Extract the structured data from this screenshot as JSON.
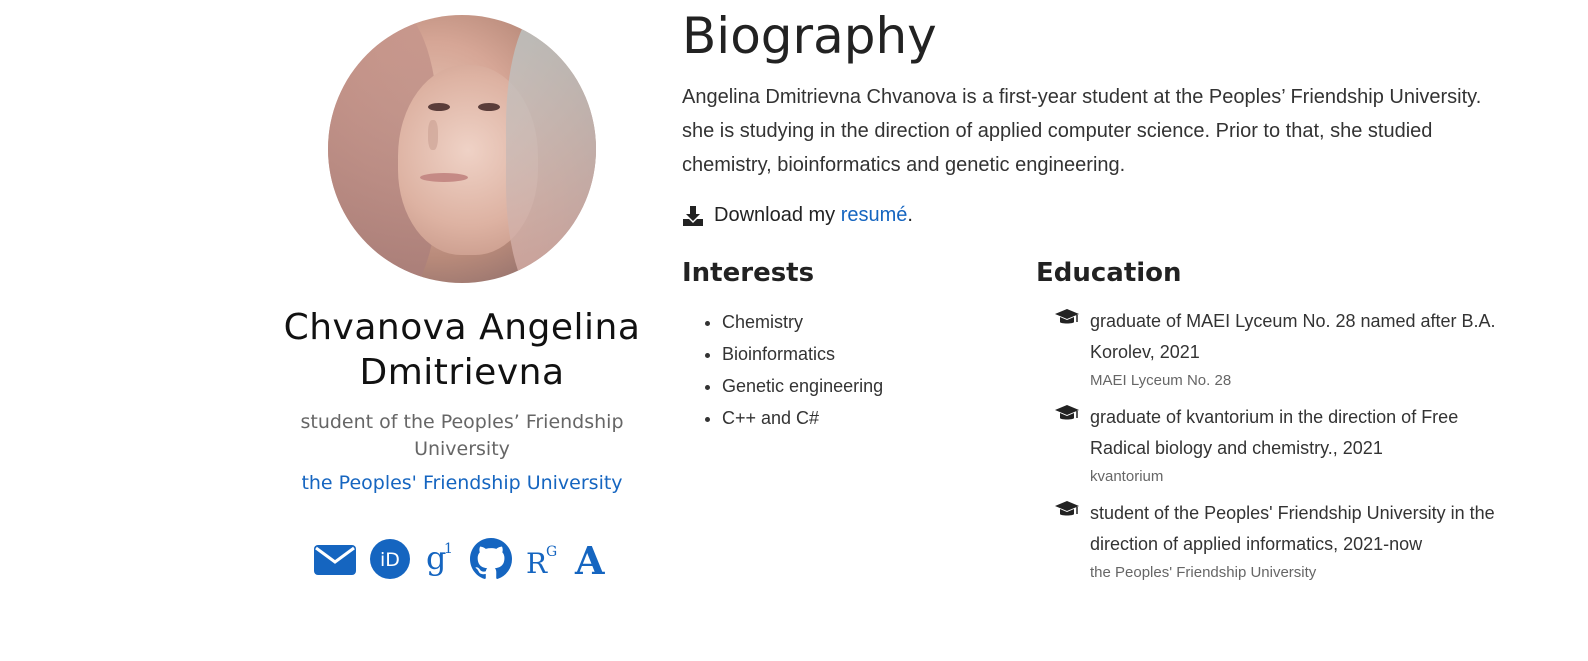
{
  "profile": {
    "name": "Chvanova Angelina Dmitrievna",
    "role": "student of the Peoples’ Friendship University",
    "organization": "the Peoples' Friendship University",
    "social": [
      {
        "name": "email-icon"
      },
      {
        "name": "orcid-icon"
      },
      {
        "name": "google-scholar-icon"
      },
      {
        "name": "github-icon"
      },
      {
        "name": "researchgate-icon"
      },
      {
        "name": "academia-icon"
      }
    ]
  },
  "biography": {
    "title": "Biography",
    "text": "Angelina Dmitrievna Chvanova is a first-year student at the Peoples’ Friendship University. she is studying in the direction of applied computer science. Prior to that, she studied chemistry, bioinformatics and genetic engineering.",
    "download_prefix": "Download my ",
    "download_link": "resumé",
    "download_suffix": "."
  },
  "interests": {
    "title": "Interests",
    "items": [
      "Chemistry",
      "Bioinformatics",
      "Genetic engineering",
      "C++ and C#"
    ]
  },
  "education": {
    "title": "Education",
    "items": [
      {
        "course": "graduate of MAEI Lyceum No. 28 named after B.A. Korolev, 2021",
        "institution": "MAEI Lyceum No. 28"
      },
      {
        "course": "graduate of kvantorium in the direction of Free Radical biology and chemistry., 2021",
        "institution": "kvantorium"
      },
      {
        "course": "student of the Peoples' Friendship University in the direction of applied informatics, 2021-now",
        "institution": "the Peoples' Friendship University"
      }
    ]
  },
  "colors": {
    "accent": "#1565c0",
    "text": "#222222",
    "muted": "#666666"
  }
}
